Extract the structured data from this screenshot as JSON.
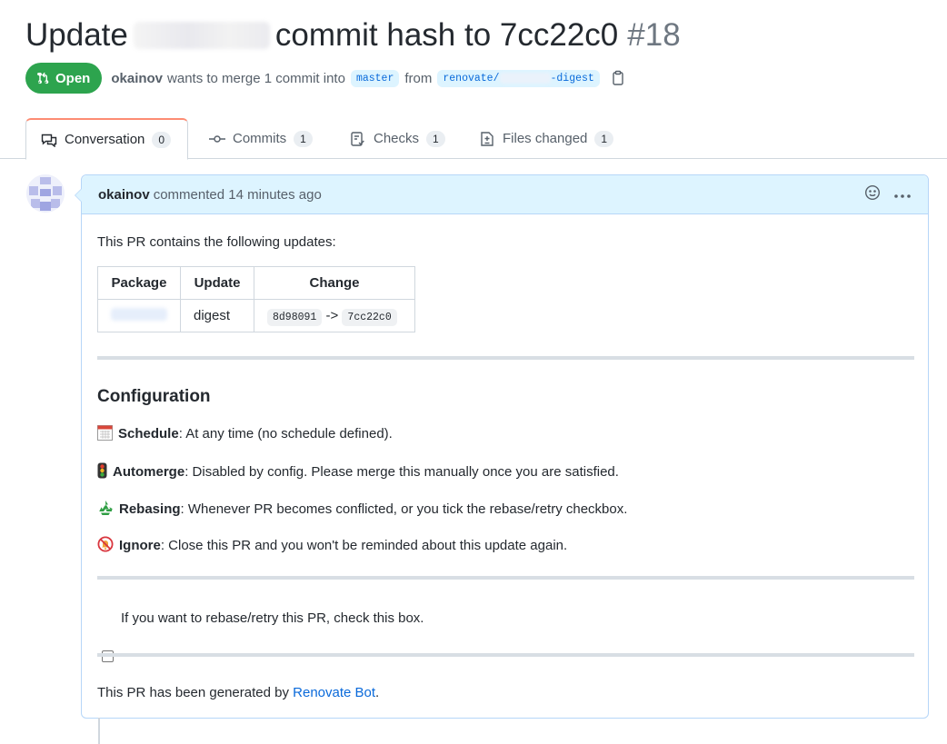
{
  "pr": {
    "title_start": "Update",
    "title_end": "commit hash to 7cc22c0",
    "number": "#18",
    "state": "Open",
    "author": "okainov",
    "merge_text": "wants to merge 1 commit into",
    "base_branch": "master",
    "from_text": "from",
    "head_branch_prefix": "renovate/",
    "head_branch_suffix": "-digest"
  },
  "tabs": [
    {
      "label": "Conversation",
      "count": "0"
    },
    {
      "label": "Commits",
      "count": "1"
    },
    {
      "label": "Checks",
      "count": "1"
    },
    {
      "label": "Files changed",
      "count": "1"
    }
  ],
  "comment": {
    "author": "okainov",
    "meta": "commented 14 minutes ago",
    "intro": "This PR contains the following updates:",
    "table": {
      "headers": [
        "Package",
        "Update",
        "Change"
      ],
      "row": {
        "update": "digest",
        "from": "8d98091",
        "arrow": "->",
        "to": "7cc22c0"
      }
    },
    "config_heading": "Configuration",
    "items": [
      {
        "label": "Schedule",
        "text": ": At any time (no schedule defined)."
      },
      {
        "label": "Automerge",
        "text": ": Disabled by config. Please merge this manually once you are satisfied."
      },
      {
        "label": "Rebasing",
        "text": ": Whenever PR becomes conflicted, or you tick the rebase/retry checkbox."
      },
      {
        "label": "Ignore",
        "text": ": Close this PR and you won't be reminded about this update again."
      }
    ],
    "checkbox_label": "If you want to rebase/retry this PR, check this box.",
    "footer_text": "This PR has been generated by",
    "footer_link": "Renovate Bot",
    "footer_end": "."
  },
  "colors": {
    "open_green": "#2da44e",
    "link_blue": "#0969da",
    "header_blue": "#ddf4ff"
  }
}
